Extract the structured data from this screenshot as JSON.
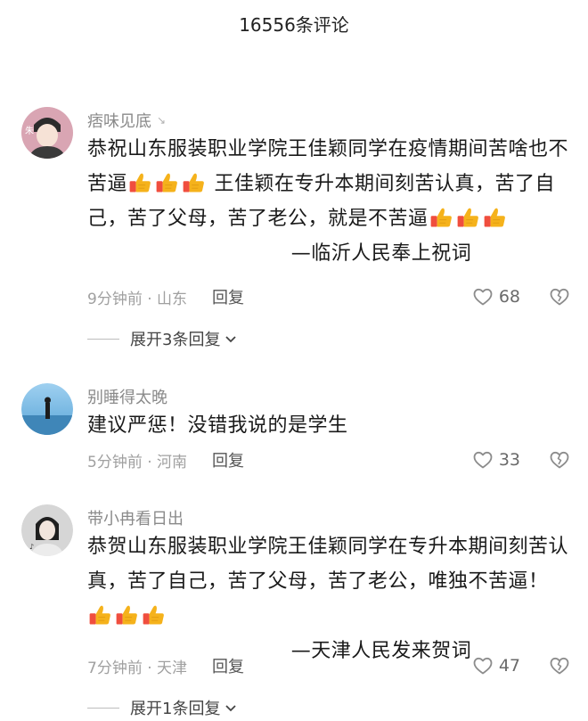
{
  "header": {
    "title": "16556条评论"
  },
  "comments": [
    {
      "username": "痞味见底",
      "author_mark": "↘",
      "text_1": "恭祝山东服装职业学院王佳颖同学在疫情期间苦啥也不苦逼",
      "text_2": "王佳颖在专升本期间刻苦认真，苦了自己，苦了父母，苦了老公，就是不苦逼",
      "signature": "—临沂人民奉上祝词",
      "time_location": "9分钟前 · 山东",
      "reply_label": "回复",
      "likes": "68",
      "expand_label": "展开3条回复"
    },
    {
      "username": "别睡得太晚",
      "text_1": "建议严惩！没错我说的是学生",
      "time_location": "5分钟前 · 河南",
      "reply_label": "回复",
      "likes": "33"
    },
    {
      "username": "带小冉看日出",
      "text_1": "恭贺山东服装职业学院王佳颖同学在专升本期间刻苦认真，苦了自己，苦了父母，苦了老公，唯独不苦逼！",
      "signature": "—天津人民发来贺词",
      "time_location": "7分钟前 · 天津",
      "reply_label": "回复",
      "likes": "47",
      "expand_label": "展开1条回复"
    }
  ],
  "colors": {
    "thumb": "#f5b21b",
    "thumb_cuff": "#f04e3e",
    "meta": "#a0a0a0"
  }
}
